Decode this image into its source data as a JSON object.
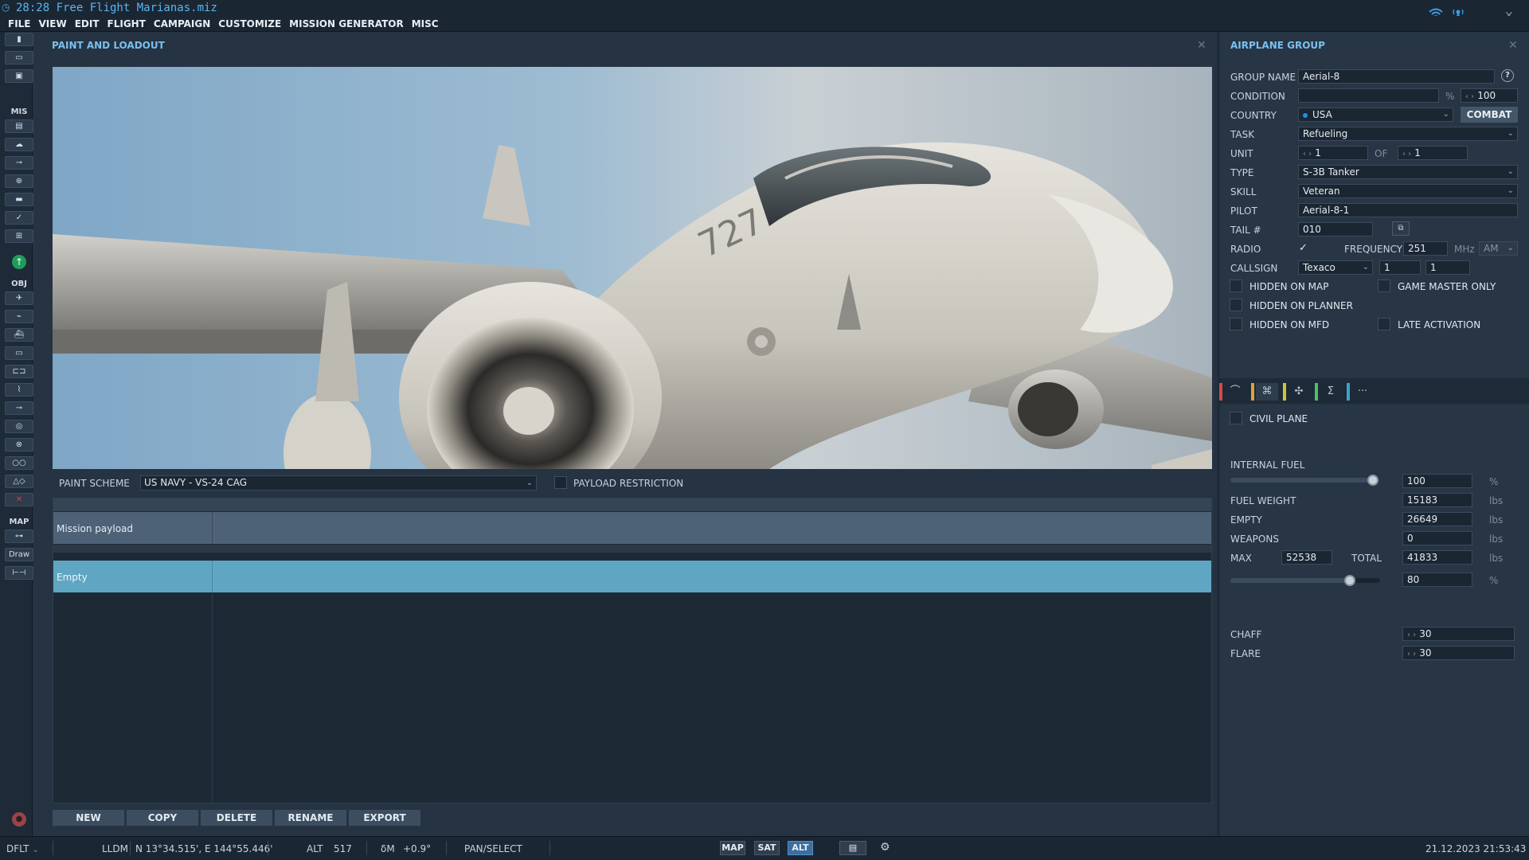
{
  "window": {
    "title": "28:28 Free Flight Marianas.miz"
  },
  "menu": [
    "FILE",
    "VIEW",
    "EDIT",
    "FLIGHT",
    "CAMPAIGN",
    "CUSTOMIZE",
    "MISSION GENERATOR",
    "MISC"
  ],
  "toolbar": {
    "sections": {
      "mis": "MIS",
      "obj": "OBJ",
      "map": "MAP"
    },
    "draw_label": "Draw"
  },
  "paint_panel": {
    "title": "PAINT AND LOADOUT",
    "paint_scheme_label": "PAINT SCHEME",
    "paint_scheme_value": "US NAVY - VS-24 CAG",
    "payload_restriction_label": "PAYLOAD RESTRICTION",
    "payload_restriction_checked": false,
    "payload_rows": [
      "Mission payload",
      "Empty"
    ],
    "selected_payload": "Empty",
    "aircraft_tail_number": "727",
    "buttons": {
      "new": "NEW",
      "copy": "COPY",
      "delete": "DELETE",
      "rename": "RENAME",
      "export": "EXPORT"
    }
  },
  "group_panel": {
    "title": "AIRPLANE GROUP",
    "help": "?",
    "group_name": {
      "label": "GROUP NAME",
      "value": "Aerial-8"
    },
    "condition": {
      "label": "CONDITION",
      "value": "",
      "unit": "%",
      "spin_value": "100"
    },
    "country": {
      "label": "COUNTRY",
      "value": "USA",
      "combat_button": "COMBAT"
    },
    "task": {
      "label": "TASK",
      "value": "Refueling"
    },
    "unit": {
      "label": "UNIT",
      "value": "1",
      "of_label": "OF",
      "of_value": "1"
    },
    "type": {
      "label": "TYPE",
      "value": "S-3B Tanker"
    },
    "skill": {
      "label": "SKILL",
      "value": "Veteran"
    },
    "pilot": {
      "label": "PILOT",
      "value": "Aerial-8-1"
    },
    "tail": {
      "label": "TAIL #",
      "value": "010"
    },
    "radio": {
      "label": "RADIO",
      "checked": true,
      "frequency_label": "FREQUENCY",
      "frequency_value": "251",
      "frequency_unit": "MHz",
      "modulation": "AM"
    },
    "callsign": {
      "label": "CALLSIGN",
      "value": "Texaco",
      "num1": "1",
      "num2": "1"
    },
    "flags": {
      "hidden_on_map": "HIDDEN ON MAP",
      "game_master_only": "GAME MASTER ONLY",
      "hidden_on_planner": "HIDDEN ON PLANNER",
      "hidden_on_mfd": "HIDDEN ON MFD",
      "late_activation": "LATE ACTIVATION"
    },
    "tab_icons": [
      "route-icon",
      "target-icon",
      "loadout-icon",
      "summary-icon",
      "more-icon"
    ],
    "tab_colors": [
      "#d54a4a",
      "#e0a03a",
      "#d2c23a",
      "#4cbf6b",
      "#3aa3c8"
    ],
    "tab_glyphs": [
      "⌒",
      "⌘",
      "✣",
      "Σ",
      "···"
    ],
    "civil_plane": "CIVIL PLANE",
    "fuel": {
      "internal_fuel_label": "INTERNAL FUEL",
      "internal_fuel_value": "100",
      "internal_fuel_fraction": 0.97,
      "pct": "%",
      "fuel_weight_label": "FUEL WEIGHT",
      "fuel_weight_value": "15183",
      "empty_label": "EMPTY",
      "empty_value": "26649",
      "weapons_label": "WEAPONS",
      "weapons_value": "0",
      "max_label": "MAX",
      "max_value": "52538",
      "total_label": "TOTAL",
      "total_value": "41833",
      "lbs": "lbs",
      "load_value": "80",
      "load_fraction": 0.8
    },
    "chaff": {
      "label": "CHAFF",
      "value": "30"
    },
    "flare": {
      "label": "FLARE",
      "value": "30"
    }
  },
  "statusbar": {
    "profile": "DFLT",
    "coord_mode": "LLDM",
    "coords": "N 13°34.515', E 144°55.446'",
    "alt_label": "ALT",
    "alt_value": "517",
    "delta_label": "δM",
    "delta_value": "+0.9°",
    "mode": "PAN/SELECT",
    "map_buttons": [
      "MAP",
      "SAT",
      "ALT"
    ],
    "active_map_button": "ALT",
    "datetime": "21.12.2023 21:53:43"
  }
}
